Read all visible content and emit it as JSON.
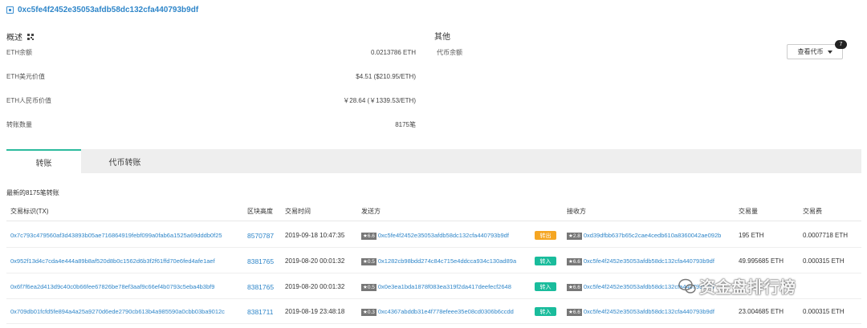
{
  "address": "0xc5fe4f2452e35053afdb58dc132cfa440793b9df",
  "overview": {
    "title": "概述",
    "rows": [
      {
        "label": "ETH余额",
        "value": "0.0213786 ETH"
      },
      {
        "label": "ETH美元价值",
        "value": "$4.51 ($210.95/ETH)"
      },
      {
        "label": "ETH人民币价值",
        "value": "￥28.64 (￥1339.53/ETH)"
      },
      {
        "label": "转账数量",
        "value": "8175笔"
      }
    ]
  },
  "other": {
    "title": "其他",
    "token_balance_label": "代币余额",
    "token_button_label": "查看代币",
    "token_count": "7"
  },
  "tabs": [
    {
      "label": "转账",
      "active": true
    },
    {
      "label": "代币转账",
      "active": false
    }
  ],
  "tx_summary": "最新的8175笔转账",
  "table": {
    "headers": {
      "hash": "交易标识(TX)",
      "block": "区块高度",
      "time": "交易时间",
      "from": "发送方",
      "to": "接收方",
      "amount": "交易量",
      "fee": "交易费"
    },
    "rows": [
      {
        "hash": "0x7c793c479560af3d43893b05ae716864919febf099a0fab6a1525a69dddb0f25",
        "block": "8570787",
        "time": "2019-09-18 10:47:35",
        "from_score": "★6.6",
        "from": "0xc5fe4f2452e35053afdb58dc132cfa440793b9df",
        "direction": "转出",
        "to_score": "★2.8",
        "to": "0xd39dfbb637b65c2cae4cedb610a8360042ae092b",
        "amount": "195 ETH",
        "fee": "0.0007718 ETH"
      },
      {
        "hash": "0x952f13d4c7cda4e444a89b8af520d8b0c1562d6b3f2f61ffd70e6fed4afe1aef",
        "block": "8381765",
        "time": "2019-08-20 00:01:32",
        "from_score": "★0.5",
        "from": "0x1282cb98bdd274c84c715e4ddcca934c130ad89a",
        "direction": "转入",
        "to_score": "★6.6",
        "to": "0xc5fe4f2452e35053afdb58dc132cfa440793b9df",
        "amount": "49.995685 ETH",
        "fee": "0.000315 ETH"
      },
      {
        "hash": "0x6f7f6ea2d413d9c40c0b66fee67826be78ef3aaf9c66ef4b0793c5eba4b3bf9",
        "block": "8381765",
        "time": "2019-08-20 00:01:32",
        "from_score": "★0.5",
        "from": "0x0e3ea1bda1878f083ea319f2da417deefecf2648",
        "direction": "转入",
        "to_score": "★6.6",
        "to": "0xc5fe4f2452e35053afdb58dc132cfa440793b9df",
        "amount": "",
        "fee": ""
      },
      {
        "hash": "0x709db01fcfd5fe894a4a25a9270d6ede2790cb613b4a985590a0cbb03ba9012c",
        "block": "8381711",
        "time": "2019-08-19 23:48:18",
        "from_score": "★0.3",
        "from": "0xc4367abddb31e4f778efeee35e08cd0306b6ccdd",
        "direction": "转入",
        "to_score": "★6.6",
        "to": "0xc5fe4f2452e35053afdb58dc132cfa440793b9df",
        "amount": "23.004685 ETH",
        "fee": "0.000315 ETH"
      }
    ]
  },
  "watermark": "资金盘排行榜",
  "colors": {
    "link": "#2f86c9",
    "tab_accent": "#2cbb9d",
    "out_badge": "#f5a623",
    "in_badge": "#1abc9c"
  }
}
